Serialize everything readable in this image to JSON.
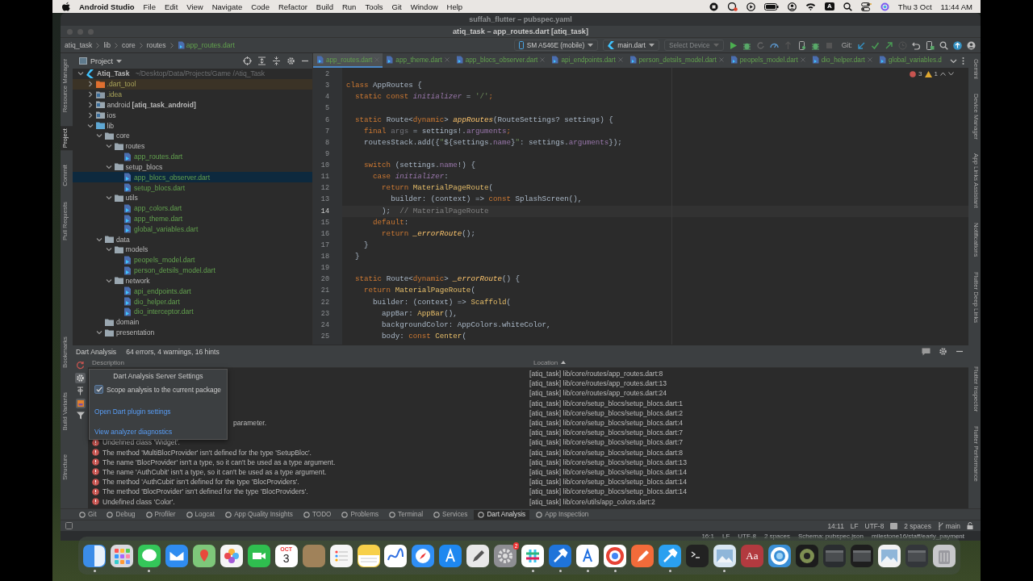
{
  "menubar": {
    "app": "Android Studio",
    "menus": [
      "File",
      "Edit",
      "View",
      "Navigate",
      "Code",
      "Refactor",
      "Build",
      "Run",
      "Tools",
      "Git",
      "Window",
      "Help"
    ],
    "input_source": "A",
    "date": "Thu 3 Oct",
    "time": "11:44 AM"
  },
  "background_window": {
    "title": "suffah_flutter – pubspec.yaml",
    "status": [
      "16:1",
      "LF",
      "UTF-8",
      "2 spaces",
      "Schema: pubspec.json",
      "milestone16/staff/early_payment"
    ]
  },
  "window": {
    "title": "atiq_task – app_routes.dart [atiq_task]"
  },
  "breadcrumbs": [
    {
      "label": "atiq_task",
      "kind": "folder"
    },
    {
      "label": "lib",
      "kind": "folder"
    },
    {
      "label": "core",
      "kind": "folder"
    },
    {
      "label": "routes",
      "kind": "folder"
    },
    {
      "label": "app_routes.dart",
      "kind": "file"
    }
  ],
  "toolbar": {
    "device": "SM A546E (mobile)",
    "run_config": "main.dart",
    "target": {
      "label": "Select Device",
      "disabled": true
    },
    "git_label": "Git:"
  },
  "left_stripe": {
    "top": [
      {
        "label": "Resource Manager",
        "selected": false
      },
      {
        "label": "Project",
        "selected": true
      },
      {
        "label": "Commit",
        "selected": false
      },
      {
        "label": "Pull Requests",
        "selected": false
      }
    ],
    "bottom": [
      {
        "label": "Bookmarks",
        "selected": false
      },
      {
        "label": "Build Variants",
        "selected": false
      },
      {
        "label": "Structure",
        "selected": false
      }
    ]
  },
  "right_stripe": {
    "top": [
      {
        "label": "Gemini",
        "selected": false
      },
      {
        "label": "Device Manager",
        "selected": false
      },
      {
        "label": "App Links Assistant",
        "selected": false
      },
      {
        "label": "Notifications",
        "selected": false
      },
      {
        "label": "Flutter Deep Links",
        "selected": false
      }
    ],
    "bottom": [
      {
        "label": "Flutter Inspector",
        "selected": false
      },
      {
        "label": "Flutter Performance",
        "selected": false
      }
    ]
  },
  "project": {
    "title": "Project",
    "tree": [
      {
        "label": "Atiq_Task",
        "kind": "module",
        "hint": "~/Desktop/Data/Projects/Game /Atiq_Task",
        "expanded": true,
        "selected": false,
        "children": [
          {
            "label": ".dart_tool",
            "kind": "excluded",
            "expanded": false,
            "selected": false
          },
          {
            "label": ".idea",
            "kind": "idea",
            "expanded": false,
            "selected": false
          },
          {
            "label": "android **[atiq_task_android]**",
            "kind": "module-folder",
            "expanded": false,
            "selected": false
          },
          {
            "label": "ios",
            "kind": "module-folder",
            "expanded": false,
            "selected": false
          },
          {
            "label": "lib",
            "kind": "source",
            "expanded": true,
            "selected": false,
            "children": [
              {
                "label": "core",
                "kind": "folder",
                "expanded": true,
                "selected": false,
                "children": [
                  {
                    "label": "routes",
                    "kind": "folder",
                    "expanded": true,
                    "selected": false,
                    "children": [
                      {
                        "label": "app_routes.dart",
                        "kind": "dart",
                        "selected": false
                      }
                    ]
                  },
                  {
                    "label": "setup_blocs",
                    "kind": "folder",
                    "expanded": true,
                    "selected": false,
                    "children": [
                      {
                        "label": "app_blocs_observer.dart",
                        "kind": "dart",
                        "selected": true
                      },
                      {
                        "label": "setup_blocs.dart",
                        "kind": "dart",
                        "selected": false
                      }
                    ]
                  },
                  {
                    "label": "utils",
                    "kind": "folder",
                    "expanded": true,
                    "selected": false,
                    "children": [
                      {
                        "label": "app_colors.dart",
                        "kind": "dart",
                        "selected": false
                      },
                      {
                        "label": "app_theme.dart",
                        "kind": "dart",
                        "selected": false
                      },
                      {
                        "label": "global_variables.dart",
                        "kind": "dart",
                        "selected": false
                      }
                    ]
                  }
                ]
              },
              {
                "label": "data",
                "kind": "folder",
                "expanded": true,
                "selected": false,
                "children": [
                  {
                    "label": "models",
                    "kind": "folder",
                    "expanded": true,
                    "selected": false,
                    "children": [
                      {
                        "label": "peopels_model.dart",
                        "kind": "dart",
                        "selected": false
                      },
                      {
                        "label": "person_detsils_model.dart",
                        "kind": "dart",
                        "selected": false
                      }
                    ]
                  },
                  {
                    "label": "network",
                    "kind": "folder",
                    "expanded": true,
                    "selected": false,
                    "children": [
                      {
                        "label": "api_endpoints.dart",
                        "kind": "dart",
                        "selected": false
                      },
                      {
                        "label": "dio_helper.dart",
                        "kind": "dart",
                        "selected": false
                      },
                      {
                        "label": "dio_interceptor.dart",
                        "kind": "dart",
                        "selected": false
                      }
                    ]
                  }
                ]
              },
              {
                "label": "domain",
                "kind": "folder",
                "selected": false
              },
              {
                "label": "presentation",
                "kind": "folder",
                "expanded": true,
                "selected": false
              }
            ]
          }
        ]
      }
    ]
  },
  "editor": {
    "tabs": [
      {
        "label": "app_routes.dart",
        "selected": true,
        "closable": true
      },
      {
        "label": "app_theme.dart",
        "selected": false,
        "closable": true
      },
      {
        "label": "app_blocs_observer.dart",
        "selected": false,
        "closable": true
      },
      {
        "label": "api_endpoints.dart",
        "selected": false,
        "closable": true
      },
      {
        "label": "person_detsils_model.dart",
        "selected": false,
        "closable": true
      },
      {
        "label": "peopels_model.dart",
        "selected": false,
        "closable": true
      },
      {
        "label": "dio_helper.dart",
        "selected": false,
        "closable": true
      },
      {
        "label": "global_variables.d",
        "selected": false,
        "closable": false
      }
    ],
    "errors": "3",
    "warnings": "1",
    "lines": [
      {
        "n": "2",
        "current": false
      },
      {
        "n": "3",
        "current": false,
        "tokens": [
          {
            "text": "class ",
            "kind": "kw"
          },
          {
            "text": "AppRoutes {",
            "kind": "plain"
          }
        ]
      },
      {
        "n": "4",
        "current": false,
        "tokens": [
          {
            "text": "  static const ",
            "kind": "kw"
          },
          {
            "text": "initializer",
            "kind": "const"
          },
          {
            "text": " = ",
            "kind": "plain"
          },
          {
            "text": "'/'",
            "kind": "str"
          },
          {
            "text": ";",
            "kind": "kw"
          }
        ]
      },
      {
        "n": "5",
        "current": false
      },
      {
        "n": "6",
        "current": false,
        "tokens": [
          {
            "text": "  static ",
            "kind": "kw"
          },
          {
            "text": "Route<",
            "kind": "plain"
          },
          {
            "text": "dynamic",
            "kind": "kw"
          },
          {
            "text": "> ",
            "kind": "plain"
          },
          {
            "text": "appRoutes",
            "kind": "fn"
          },
          {
            "text": "(RouteSettings? settings) {",
            "kind": "plain"
          }
        ]
      },
      {
        "n": "7",
        "current": false,
        "tokens": [
          {
            "text": "    final ",
            "kind": "kw"
          },
          {
            "text": "args",
            "kind": "unused"
          },
          {
            "text": " = settings!.",
            "kind": "plain"
          },
          {
            "text": "arguments",
            "kind": "field"
          },
          {
            "text": ";",
            "kind": "kw"
          }
        ]
      },
      {
        "n": "8",
        "current": false,
        "tokens": [
          {
            "text": "    routesStack.add({",
            "kind": "plain"
          },
          {
            "text": "\"",
            "kind": "str"
          },
          {
            "text": "${settings.",
            "kind": "plain"
          },
          {
            "text": "name",
            "kind": "field"
          },
          {
            "text": "}",
            "kind": "plain"
          },
          {
            "text": "\"",
            "kind": "str"
          },
          {
            "text": ": settings.",
            "kind": "plain"
          },
          {
            "text": "arguments",
            "kind": "field"
          },
          {
            "text": "});",
            "kind": "plain"
          }
        ]
      },
      {
        "n": "9",
        "current": false
      },
      {
        "n": "10",
        "current": false,
        "tokens": [
          {
            "text": "    switch",
            "kind": "kw"
          },
          {
            "text": " (settings.",
            "kind": "plain"
          },
          {
            "text": "name",
            "kind": "field"
          },
          {
            "text": "!) {",
            "kind": "plain"
          }
        ]
      },
      {
        "n": "11",
        "current": false,
        "tokens": [
          {
            "text": "      case ",
            "kind": "kw"
          },
          {
            "text": "initializer",
            "kind": "const"
          },
          {
            "text": ":",
            "kind": "plain"
          }
        ]
      },
      {
        "n": "12",
        "current": false,
        "tokens": [
          {
            "text": "        return ",
            "kind": "kw"
          },
          {
            "text": "MaterialPageRoute",
            "kind": "cls"
          },
          {
            "text": "(",
            "kind": "plain"
          }
        ]
      },
      {
        "n": "13",
        "current": false,
        "tokens": [
          {
            "text": "          builder: (context) => ",
            "kind": "plain"
          },
          {
            "text": "const ",
            "kind": "kw"
          },
          {
            "text": "SplashScreen(),",
            "kind": "plain"
          }
        ]
      },
      {
        "n": "14",
        "current": true,
        "tokens": [
          {
            "text": "        );",
            "kind": "plain"
          },
          {
            "text": "  // MaterialPageRoute",
            "kind": "cmt"
          }
        ]
      },
      {
        "n": "15",
        "current": false,
        "tokens": [
          {
            "text": "      default",
            "kind": "kw"
          },
          {
            "text": ":",
            "kind": "plain"
          }
        ]
      },
      {
        "n": "16",
        "current": false,
        "tokens": [
          {
            "text": "        return ",
            "kind": "kw"
          },
          {
            "text": "_errorRoute",
            "kind": "fn"
          },
          {
            "text": "();",
            "kind": "plain"
          }
        ]
      },
      {
        "n": "17",
        "current": false,
        "tokens": [
          {
            "text": "    }",
            "kind": "plain"
          }
        ]
      },
      {
        "n": "18",
        "current": false,
        "tokens": [
          {
            "text": "  }",
            "kind": "plain"
          }
        ]
      },
      {
        "n": "19",
        "current": false
      },
      {
        "n": "20",
        "current": false,
        "tokens": [
          {
            "text": "  static ",
            "kind": "kw"
          },
          {
            "text": "Route<",
            "kind": "plain"
          },
          {
            "text": "dynamic",
            "kind": "kw"
          },
          {
            "text": "> ",
            "kind": "plain"
          },
          {
            "text": "_errorRoute",
            "kind": "fn"
          },
          {
            "text": "() {",
            "kind": "plain"
          }
        ]
      },
      {
        "n": "21",
        "current": false,
        "tokens": [
          {
            "text": "    return ",
            "kind": "kw"
          },
          {
            "text": "MaterialPageRoute",
            "kind": "cls"
          },
          {
            "text": "(",
            "kind": "plain"
          }
        ]
      },
      {
        "n": "22",
        "current": false,
        "tokens": [
          {
            "text": "      builder: (context) => ",
            "kind": "plain"
          },
          {
            "text": "Scaffold",
            "kind": "cls"
          },
          {
            "text": "(",
            "kind": "plain"
          }
        ]
      },
      {
        "n": "23",
        "current": false,
        "tokens": [
          {
            "text": "        appBar: ",
            "kind": "plain"
          },
          {
            "text": "AppBar",
            "kind": "cls"
          },
          {
            "text": "(),",
            "kind": "plain"
          }
        ]
      },
      {
        "n": "24",
        "current": false,
        "tokens": [
          {
            "text": "        backgroundColor: AppColors.whiteColor,",
            "kind": "plain"
          }
        ]
      },
      {
        "n": "25",
        "current": false,
        "tokens": [
          {
            "text": "        body: ",
            "kind": "plain"
          },
          {
            "text": "const ",
            "kind": "kw"
          },
          {
            "text": "Center",
            "kind": "cls"
          },
          {
            "text": "(",
            "kind": "plain"
          }
        ]
      }
    ]
  },
  "analysis": {
    "title": "Dart Analysis",
    "summary": "64 errors, 4 warnings, 16 hints",
    "columns": [
      {
        "label": "Description",
        "sorted": false
      },
      {
        "label": "Location",
        "sorted": true
      }
    ],
    "rows": [
      {
        "kind": "covered",
        "location": "[atiq_task] lib/core/routes/app_routes.dart:8"
      },
      {
        "kind": "covered",
        "location": "[atiq_task] lib/core/routes/app_routes.dart:13"
      },
      {
        "kind": "covered",
        "location": "[atiq_task] lib/core/routes/app_routes.dart:24"
      },
      {
        "kind": "covered",
        "location": "[atiq_task] lib/core/setup_blocs/setup_blocs.dart:1"
      },
      {
        "kind": "covered",
        "location": "[atiq_task] lib/core/setup_blocs/setup_blocs.dart:2"
      },
      {
        "kind": "covered",
        "description": "parameter.",
        "location": "[atiq_task] lib/core/setup_blocs/setup_blocs.dart:4"
      },
      {
        "kind": "covered",
        "location": "[atiq_task] lib/core/setup_blocs/setup_blocs.dart:7"
      },
      {
        "kind": "error",
        "description": "Undefined class 'Widget'.",
        "location": "[atiq_task] lib/core/setup_blocs/setup_blocs.dart:7"
      },
      {
        "kind": "error",
        "description": "The method 'MultiBlocProvider' isn't defined for the type 'SetupBloc'.",
        "location": "[atiq_task] lib/core/setup_blocs/setup_blocs.dart:8"
      },
      {
        "kind": "error",
        "description": "The name 'BlocProvider' isn't a type, so it can't be used as a type argument.",
        "location": "[atiq_task] lib/core/setup_blocs/setup_blocs.dart:13"
      },
      {
        "kind": "error",
        "description": "The name 'AuthCubit' isn't a type, so it can't be used as a type argument.",
        "location": "[atiq_task] lib/core/setup_blocs/setup_blocs.dart:14"
      },
      {
        "kind": "error",
        "description": "The method 'AuthCubit' isn't defined for the type 'BlocProviders'.",
        "location": "[atiq_task] lib/core/setup_blocs/setup_blocs.dart:14"
      },
      {
        "kind": "error",
        "description": "The method 'BlocProvider' isn't defined for the type 'BlocProviders'.",
        "location": "[atiq_task] lib/core/setup_blocs/setup_blocs.dart:14"
      },
      {
        "kind": "error",
        "description": "Undefined class 'Color'.",
        "location": "[atiq_task] lib/core/utils/app_colors.dart:2"
      }
    ],
    "popup": {
      "title": "Dart Analysis Server Settings",
      "option": {
        "label": "Scope analysis to the current package",
        "checked": true
      },
      "links": [
        "Open Dart plugin settings",
        "View analyzer diagnostics"
      ]
    }
  },
  "tool_tabs": [
    {
      "label": "Git",
      "selected": false
    },
    {
      "label": "Debug",
      "selected": false
    },
    {
      "label": "Profiler",
      "selected": false
    },
    {
      "label": "Logcat",
      "selected": false
    },
    {
      "label": "App Quality Insights",
      "selected": false
    },
    {
      "label": "TODO",
      "selected": false
    },
    {
      "label": "Problems",
      "selected": false
    },
    {
      "label": "Terminal",
      "selected": false
    },
    {
      "label": "Services",
      "selected": false
    },
    {
      "label": "Dart Analysis",
      "selected": true
    },
    {
      "label": "App Inspection",
      "selected": false
    }
  ],
  "status_bar": {
    "position": "14:11",
    "line_ending": "LF",
    "encoding": "UTF-8",
    "indent": "2 spaces",
    "branch": "main"
  },
  "dock": [
    {
      "kind": "split",
      "color": "#3b8de8",
      "running": true
    },
    {
      "kind": "grid",
      "color": "#d9d9de",
      "running": false
    },
    {
      "kind": "bubble",
      "color": "#34c759",
      "running": true
    },
    {
      "kind": "envelope",
      "color": "#2f8cf0",
      "running": false
    },
    {
      "kind": "pin",
      "color": "#7ec77a",
      "running": false
    },
    {
      "kind": "petals",
      "color": "#f5f5f5",
      "running": false
    },
    {
      "kind": "camera",
      "color": "#2fbe4f",
      "running": false
    },
    {
      "kind": "calendar",
      "color": "#ffffff",
      "month": "OCT",
      "day": "3",
      "running": false
    },
    {
      "kind": "plain",
      "color": "#a0825a",
      "running": false
    },
    {
      "kind": "list",
      "color": "#f5f5f5",
      "running": false
    },
    {
      "kind": "lines",
      "color": "#f7d04a",
      "running": false
    },
    {
      "kind": "wave",
      "color": "#ffffff",
      "running": false
    },
    {
      "kind": "compass",
      "color": "#2f8ef5",
      "running": false
    },
    {
      "kind": "letter",
      "color": "#1e88f0",
      "running": false
    },
    {
      "kind": "pencil",
      "color": "#e8e8e8",
      "running": false
    },
    {
      "kind": "gear",
      "color": "#8e8e93",
      "badge": "2",
      "running": false
    },
    {
      "kind": "hash",
      "color": "#ffffff",
      "running": true
    },
    {
      "kind": "hammer",
      "color": "#1f74d9",
      "running": true
    },
    {
      "kind": "letter",
      "color": "#ffffff",
      "running": true
    },
    {
      "kind": "ring",
      "color": "#ffffff",
      "running": true
    },
    {
      "kind": "pencil",
      "color": "#f26b3a",
      "running": false
    },
    {
      "kind": "hammer",
      "color": "#2aa0f0",
      "running": true
    },
    {
      "kind": "terminal",
      "color": "#222222",
      "running": false
    },
    {
      "kind": "photo",
      "color": "#d8e6f2",
      "running": true
    },
    {
      "kind": "text",
      "color": "#b23a3f",
      "label": "Aa",
      "running": false
    },
    {
      "kind": "ring",
      "color": "#3a8fd6",
      "running": false
    },
    {
      "kind": "eye",
      "color": "#1c1c1c",
      "running": false
    },
    {
      "kind": "window",
      "color": "#2a2d30",
      "running": false
    },
    {
      "kind": "window",
      "color": "#1e1e1e",
      "running": false
    },
    {
      "kind": "photo",
      "color": "#f2f2f2",
      "running": false
    },
    {
      "kind": "window",
      "color": "#33363a",
      "running": false
    },
    {
      "kind": "trash",
      "color": "#c8c8cc",
      "running": false
    }
  ]
}
